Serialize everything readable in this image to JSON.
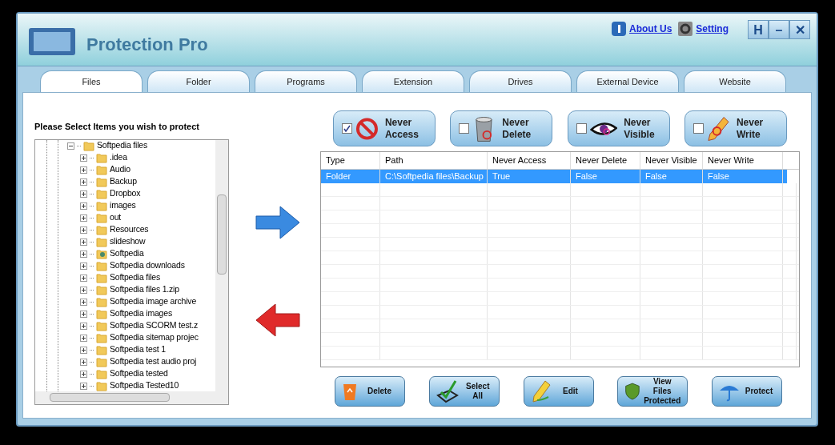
{
  "window": {
    "title": "Protection Pro"
  },
  "header_links": [
    {
      "label": "About Us",
      "kind": "info"
    },
    {
      "label": "Setting",
      "kind": "gear"
    }
  ],
  "window_buttons": [
    "H",
    "–",
    "✕"
  ],
  "tabs": [
    {
      "label": "Files",
      "selected": true
    },
    {
      "label": "Folder",
      "selected": false
    },
    {
      "label": "Programs",
      "selected": false
    },
    {
      "label": "Extension",
      "selected": false
    },
    {
      "label": "Drives",
      "selected": false
    },
    {
      "label": "External Device",
      "selected": false
    },
    {
      "label": "Website",
      "selected": false
    }
  ],
  "tree_label": "Please Select Items you wish to protect",
  "tree": [
    {
      "label": "Softpedia files",
      "kind": "folder",
      "expanded": true,
      "children": [
        {
          "label": ".idea",
          "kind": "folder",
          "expanded": false
        },
        {
          "label": "Audio",
          "kind": "folder",
          "expanded": false
        },
        {
          "label": "Backup",
          "kind": "folder",
          "expanded": false
        },
        {
          "label": "Dropbox",
          "kind": "folder",
          "expanded": false
        },
        {
          "label": "images",
          "kind": "folder",
          "expanded": false
        },
        {
          "label": "out",
          "kind": "folder",
          "expanded": false
        },
        {
          "label": "Resources",
          "kind": "folder",
          "expanded": false
        },
        {
          "label": "slideshow",
          "kind": "folder",
          "expanded": false
        },
        {
          "label": "Softpedia",
          "kind": "user",
          "expanded": false
        },
        {
          "label": "Softpedia downloads",
          "kind": "folder",
          "expanded": false
        },
        {
          "label": "Softpedia files",
          "kind": "folder",
          "expanded": false
        },
        {
          "label": "Softpedia files 1.zip",
          "kind": "folder",
          "expanded": false
        },
        {
          "label": "Softpedia image archive",
          "kind": "folder",
          "expanded": false
        },
        {
          "label": "Softpedia images",
          "kind": "folder",
          "expanded": false
        },
        {
          "label": "Softpedia SCORM test.z",
          "kind": "folder",
          "expanded": false
        },
        {
          "label": "Softpedia sitemap projec",
          "kind": "folder",
          "expanded": false
        },
        {
          "label": "Softpedia test 1",
          "kind": "folder",
          "expanded": false
        },
        {
          "label": "Softpedia test audio proj",
          "kind": "folder",
          "expanded": false
        },
        {
          "label": "Softpedia tested",
          "kind": "folder",
          "expanded": false
        },
        {
          "label": "Softpedia Tested10",
          "kind": "folder",
          "expanded": false
        }
      ]
    }
  ],
  "options": [
    {
      "label": "Never Access",
      "kind": "access",
      "checked": true
    },
    {
      "label": "Never Delete",
      "kind": "delete",
      "checked": false
    },
    {
      "label": "Never Visible",
      "kind": "visible",
      "checked": false
    },
    {
      "label": "Never Write",
      "kind": "write",
      "checked": false
    }
  ],
  "table": {
    "columns": [
      "Type",
      "Path",
      "Never Access",
      "Never Delete",
      "Never Visible",
      "Never Write"
    ],
    "rows": [
      {
        "cells": [
          "Folder",
          "C:\\Softpedia files\\Backup",
          "True",
          "False",
          "False",
          "False"
        ],
        "selected": true
      }
    ]
  },
  "actions": [
    {
      "label": "Delete",
      "kind": "delete"
    },
    {
      "label": "Select All",
      "kind": "selectall"
    },
    {
      "label": "Edit",
      "kind": "edit"
    },
    {
      "label": "View Files Protected",
      "kind": "view"
    },
    {
      "label": "Protect",
      "kind": "protect"
    }
  ]
}
